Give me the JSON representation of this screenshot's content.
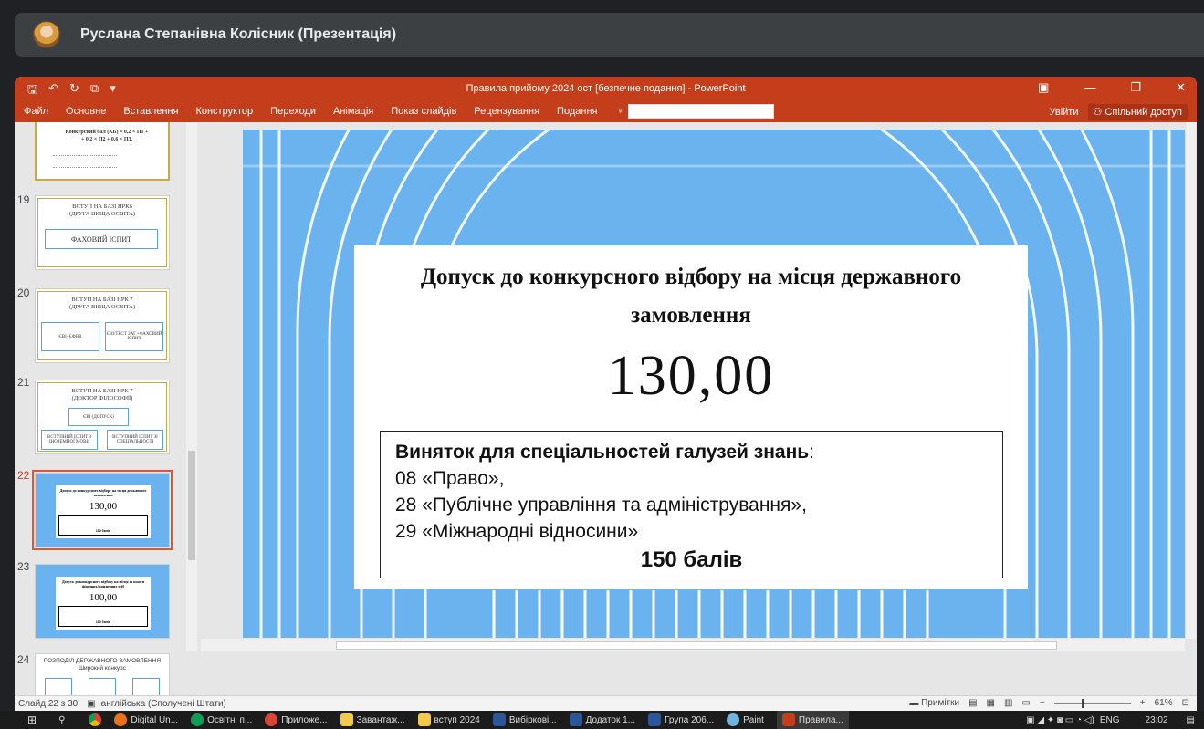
{
  "meet": {
    "presenter": "Руслана Степанівна Колісник (Презентація)"
  },
  "window": {
    "title": "Правила прийому 2024 ост [безпечне подання] - PowerPoint"
  },
  "ribbon": {
    "tabs": [
      "Файл",
      "Основне",
      "Вставлення",
      "Конструктор",
      "Переходи",
      "Анімація",
      "Показ слайдів",
      "Рецензування",
      "Подання"
    ],
    "signin": "Увійти",
    "share": "Спільний доступ"
  },
  "thumbnails": [
    {
      "num": "",
      "formula": "Конкурсний бал (КБ) = 0,2 × П1 + + 0,2 × П2 + 0,6 × П3,"
    },
    {
      "num": "19",
      "line1": "ВСТУП НА БАЗІ НРК6",
      "line2": "(ДРУГА ВИЩА ОСВІТА)",
      "box": "ФАХОВИЙ ІСПИТ"
    },
    {
      "num": "20",
      "line1": "ВСТУП НА БАЗІ НРК 7",
      "line2": "(ДРУГА ВИЩА ОСВІТА)",
      "box_left": "ЄВІ+ЄФВВ",
      "box_right": "ЄВІ/ТЕСТ ЗАГ.+ФАХОВИЙ ІСПИТ"
    },
    {
      "num": "21",
      "line1": "ВСТУП НА БАЗІ НРК 7",
      "line2": "(ДОКТОР ФІЛОСОФІЇ)",
      "box_top": "ЄВІ (ДОПУСК)",
      "box_left": "ВСТУПНИЙ ІСПИТ З ІНОЗЕМНОЇ МОВИ",
      "box_right": "ВСТУПНИЙ ІСПИТ ЗІ СПЕЦІАЛЬНОСТІ"
    },
    {
      "num": "22",
      "title": "Допуск до конкурсного відбору на місця державного замовлення",
      "value": "130,00",
      "points": "150 балів"
    },
    {
      "num": "23",
      "title": "Допуск до конкурсного відбору на місця за кошти фізичних/юридичних осіб",
      "value": "100,00",
      "points": "150 балів"
    },
    {
      "num": "24",
      "line1": "РОЗПОДІЛ ДЕРЖАВНОГО ЗАМОВЛЕННЯ",
      "line2": "Широкий конкурс"
    }
  ],
  "slide": {
    "title": "Допуск до конкурсного відбору на місця державного замовлення",
    "value": "130,00",
    "exception_head": "Виняток для спеціальностей галузей знань",
    "colon": ":",
    "items": [
      "08 «Право»,",
      "28 «Публічне управління та адміністрування»,",
      "29 «Міжнародні відносини»"
    ],
    "points": "150 балів"
  },
  "statusbar": {
    "slide_info": "Слайд 22 з 30",
    "language": "англійська (Сполучені Штати)",
    "notes": "Примітки",
    "zoom": "61%"
  },
  "taskbar": {
    "items": [
      "Digital Un...",
      "Освітні п...",
      "Приложе...",
      "Завантаж...",
      "вступ 2024",
      "Вибіркові...",
      "Додаток 1...",
      "Група 206...",
      "Paint",
      "Правила..."
    ],
    "lang": "ENG",
    "time": "23:02"
  },
  "colors": {
    "ppt_red": "#c43e1c",
    "slide_blue": "#6ab3ee",
    "selected_outline": "#e2552d"
  }
}
